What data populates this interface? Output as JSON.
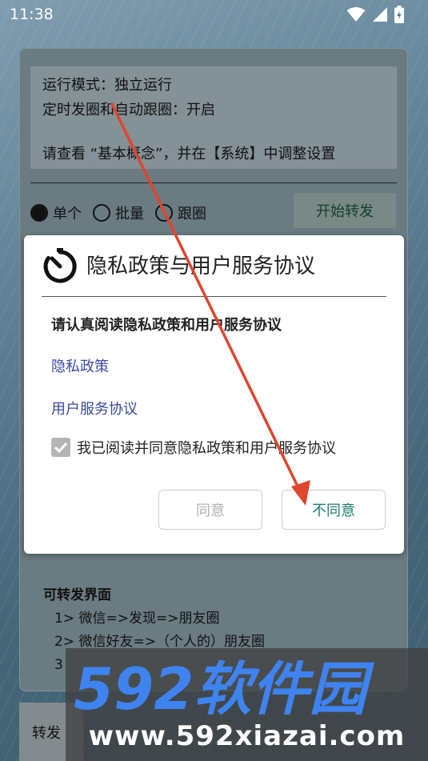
{
  "status_bar": {
    "time": "11:38",
    "icons": [
      "wifi-icon",
      "signal-icon",
      "battery-icon"
    ]
  },
  "main": {
    "info": {
      "line1": "运行模式：独立运行",
      "line2": "定时发圈和自动跟圈：开启",
      "line3": "请查看 “基本概念”，并在【系统】中调整设置"
    },
    "modes": [
      {
        "label": "单个",
        "selected": true
      },
      {
        "label": "批量",
        "selected": false
      },
      {
        "label": "跟圈",
        "selected": false
      }
    ],
    "start_button": "开始转发",
    "pages": {
      "title": "可转发界面",
      "items": [
        "1> 微信=>发现=>朋友圈",
        "2> 微信好友=>（个人的）朋友圈",
        "3"
      ]
    },
    "bottom_tab": "转发"
  },
  "dialog": {
    "title": "隐私政策与用户服务协议",
    "subtitle": "请认真阅读隐私政策和用户服务协议",
    "link_privacy": "隐私政策",
    "link_terms": "用户服务协议",
    "agree_checkbox_label": "我已阅读并同意隐私政策和用户服务协议",
    "agree_checked": true,
    "agree_button": "同意",
    "disagree_button": "不同意"
  },
  "watermark": {
    "logo_text": "592软件园",
    "url": "www.592xiazai.com"
  },
  "colors": {
    "arrow": "#e0452d",
    "link": "#3b4aa0",
    "disagree": "#1f7d6e",
    "watermark_logo": "#3f83f0"
  }
}
